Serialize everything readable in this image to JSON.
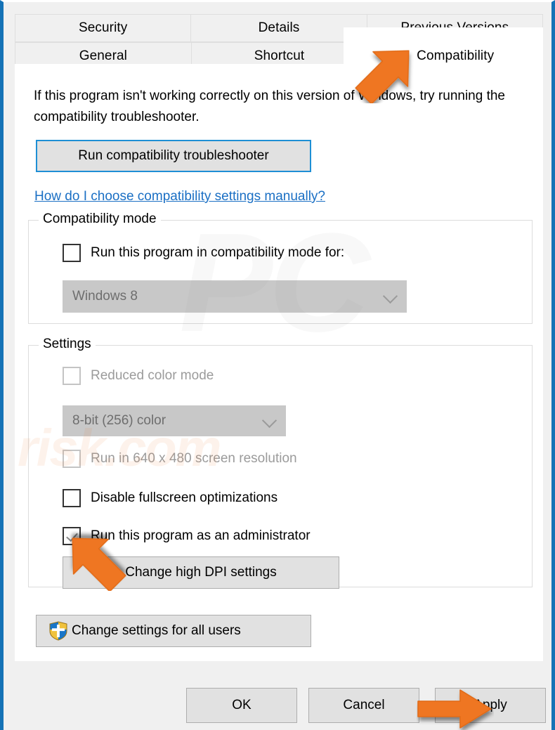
{
  "window": {
    "border_color": "#1572b6",
    "background": "#f0f0f0"
  },
  "tabs": {
    "row1": [
      {
        "label": "Security",
        "selected": false
      },
      {
        "label": "Details",
        "selected": false
      },
      {
        "label": "Previous Versions",
        "selected": false
      }
    ],
    "row2": [
      {
        "label": "General",
        "selected": false
      },
      {
        "label": "Shortcut",
        "selected": false
      },
      {
        "label": "Compatibility",
        "selected": true
      }
    ]
  },
  "page": {
    "intro_text": "If this program isn't working correctly on this version of Windows, try running the compatibility troubleshooter.",
    "troubleshoot_button": "Run compatibility troubleshooter",
    "help_link": "How do I choose compatibility settings manually?"
  },
  "compatibility_mode": {
    "group_title": "Compatibility mode",
    "checkbox_label": "Run this program in compatibility mode for:",
    "checkbox_checked": false,
    "os_select_value": "Windows 8",
    "os_select_disabled": true
  },
  "settings": {
    "group_title": "Settings",
    "reduced_color_label": "Reduced color mode",
    "reduced_color_checked": false,
    "reduced_color_disabled": true,
    "color_depth_value": "8-bit (256) color",
    "color_depth_disabled": true,
    "resolution_label": "Run in 640 x 480 screen resolution",
    "resolution_checked": false,
    "resolution_disabled": true,
    "fullscreen_label": "Disable fullscreen optimizations",
    "fullscreen_checked": false,
    "admin_label": "Run this program as an administrator",
    "admin_checked": true,
    "dpi_button": "Change high DPI settings"
  },
  "all_users_button": "Change settings for all users",
  "action_buttons": {
    "ok": "OK",
    "cancel": "Cancel",
    "apply": "Apply"
  },
  "watermark": {
    "logo_text": "PC",
    "site_text": "risk.com"
  },
  "annotations": {
    "arrow_color": "#ef7622",
    "arrow_tab_target": "Compatibility",
    "arrow_admin_target": "Run this program as an administrator",
    "arrow_apply_target": "Apply"
  }
}
